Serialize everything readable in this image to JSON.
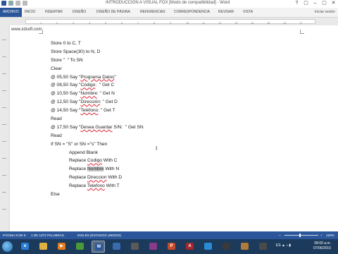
{
  "window": {
    "title": "INTRODUCCION A VISUAL FOX [Modo de compatibilidad] - Word",
    "controls": [
      "?",
      "▢",
      "–",
      "▢",
      "✕"
    ]
  },
  "ribbon": {
    "tabs": [
      "ARCHIVO",
      "INICIO",
      "INSERTAR",
      "DISEÑO",
      "DISEÑO DE PÁGINA",
      "REFERENCIAS",
      "CORRESPONDENCIA",
      "REVISAR",
      "VISTA"
    ],
    "active_tab": "ARCHIVO",
    "signin": "Iniciar sesión"
  },
  "ruler": {
    "ticks": [
      "1",
      "2",
      "3",
      "4",
      "5",
      "6",
      "7",
      "8",
      "9",
      "10",
      "11",
      "12",
      "13",
      "14",
      "15",
      "16",
      "17"
    ]
  },
  "document": {
    "watermark": "www.zdsoft.com",
    "lines": [
      "Store 0 to C, T",
      "Store Space(30) to N, D",
      "Store \"  \" To SN",
      "Clear",
      "@ 05,50 Say \"Programa Datos\"",
      "@ 08,50 Say \"Código:  \" Get C",
      "@ 10,50 Say \"Nombre: \" Get N",
      "@ 12,50 Say \"Dirección: \" Get D",
      "@ 14,50 Say \"Teléfono: \" Get T",
      "Read",
      "@ 17,50 Say \"Desea Guardar S/N:  \" Get SN",
      "Read",
      "If SN = \"S\" or SN =\"s\" Then",
      "Append Blank",
      "Replace Codigo With C",
      "Replace Nombre With N",
      "Replace Direccion With D",
      "Replace Telefono With T",
      "Else"
    ]
  },
  "statusbar": {
    "page": "PÁGINA 8 DE 9",
    "words": "1 DE 1372 PALABRAS",
    "language": "INGLÉS (ESTADOS UNIDOS)",
    "zoom": "120%",
    "zoom_minus": "–",
    "zoom_plus": "+"
  },
  "taskbar": {
    "apps": [
      {
        "name": "ie-icon",
        "color": "#2a7fd4",
        "glyph": "e"
      },
      {
        "name": "folder-icon",
        "color": "#e0b040",
        "glyph": ""
      },
      {
        "name": "media-player-icon",
        "color": "#e87a1a",
        "glyph": "▶"
      },
      {
        "name": "chrome-icon",
        "color": "#4a9a3a",
        "glyph": ""
      },
      {
        "name": "word-icon",
        "color": "#2b579a",
        "glyph": "W"
      },
      {
        "name": "app-icon-1",
        "color": "#3a6bb0",
        "glyph": ""
      },
      {
        "name": "app-icon-2",
        "color": "#5a5a5a",
        "glyph": ""
      },
      {
        "name": "app-icon-3",
        "color": "#8a3a8a",
        "glyph": ""
      },
      {
        "name": "powerpoint-icon",
        "color": "#c84a2a",
        "glyph": "P"
      },
      {
        "name": "access-icon",
        "color": "#a4262c",
        "glyph": "A"
      },
      {
        "name": "app-icon-4",
        "color": "#2a8ad4",
        "glyph": ""
      },
      {
        "name": "app-icon-5",
        "color": "#3a3a3a",
        "glyph": ""
      },
      {
        "name": "app-icon-6",
        "color": "#b07a3a",
        "glyph": ""
      },
      {
        "name": "app-icon-7",
        "color": "#4a4a4a",
        "glyph": ""
      }
    ],
    "tray": "ES  ▲ ♪ ▮",
    "time": "08:00 a.m.",
    "date": "07/06/2016"
  }
}
